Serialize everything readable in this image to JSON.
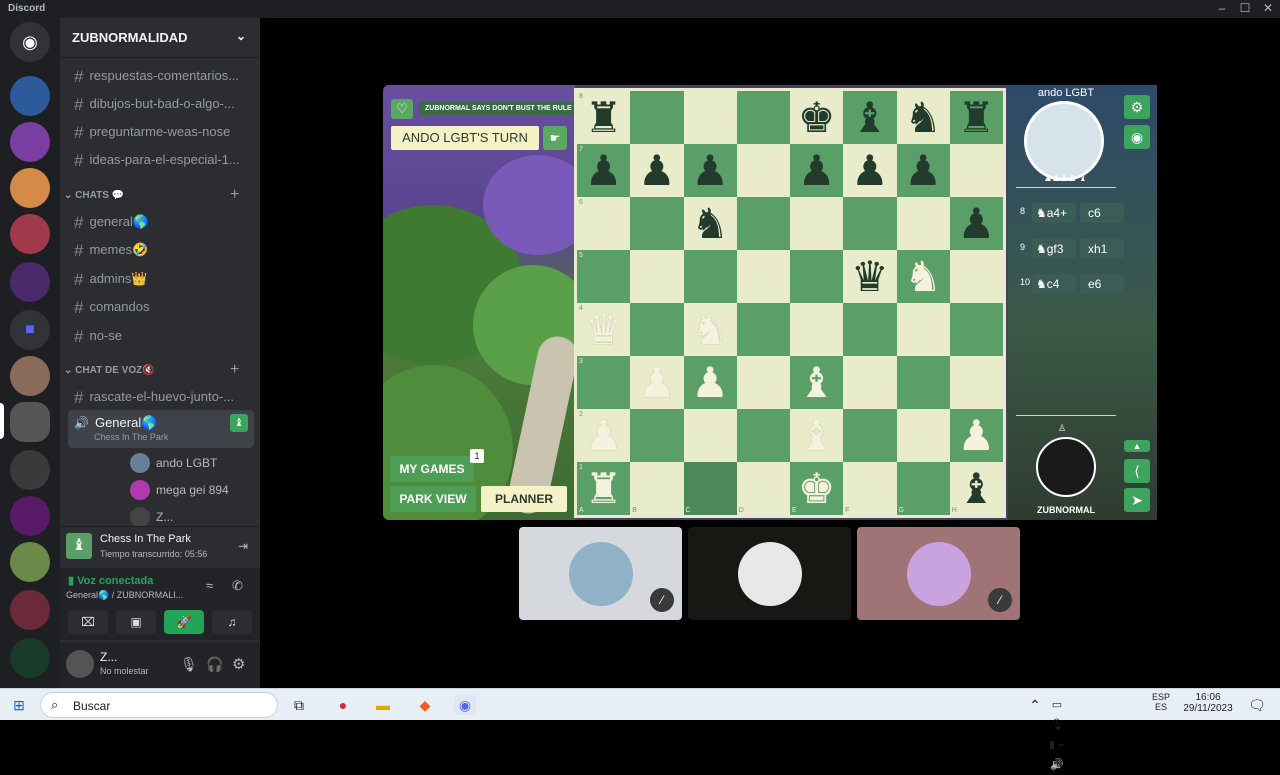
{
  "window": {
    "title": "Discord"
  },
  "server": {
    "name": "ZUBNORMALIDAD"
  },
  "channels_top": [
    {
      "name": "respuestas-comentarios..."
    },
    {
      "name": "dibujos-but-bad-o-algo-..."
    },
    {
      "name": "preguntarme-weas-nose"
    },
    {
      "name": "ideas-para-el-especial-1..."
    }
  ],
  "categories": {
    "chats": "CHATS 💬",
    "voice": "CHAT DE VOZ🔇"
  },
  "chat_channels": [
    {
      "name": "general🌎"
    },
    {
      "name": "memes🤣"
    },
    {
      "name": "admins👑"
    },
    {
      "name": "comandos"
    },
    {
      "name": "no-se"
    }
  ],
  "voice_channels": [
    {
      "name": "rascate-el-huevo-junto-..."
    },
    {
      "name": "General🌎",
      "activity": "Chess In The Park"
    }
  ],
  "voice_users": [
    {
      "name": "ando LGBT"
    },
    {
      "name": "mega gei 894"
    },
    {
      "name": "Z..."
    }
  ],
  "activity": {
    "title": "Chess In The Park",
    "elapsed": "Tiempo transcurrido: 05:56"
  },
  "voice_status": {
    "status": "Voz conectada",
    "location": "General🌎 / ZUBNORMALI..."
  },
  "user": {
    "name": "Z...",
    "status": "No molestar"
  },
  "game": {
    "rule_banner": "ZUBNORMAL SAYS DON'T BUST THE RULE",
    "turn": "ANDO LGBT'S TURN",
    "my_games": "MY GAMES",
    "my_games_badge": "1",
    "park_view": "PARK VIEW",
    "planner": "PLANNER",
    "opponent_name": "ando LGBT",
    "player_name": "ZUBNORMAL",
    "moves": [
      {
        "num": "8",
        "white": "♞a4+",
        "black": "c6"
      },
      {
        "num": "9",
        "white": "♞gf3",
        "black": "xh1"
      },
      {
        "num": "10",
        "white": "♞c4",
        "black": "e6"
      }
    ],
    "ranks": [
      "8",
      "7",
      "6",
      "5",
      "4",
      "3",
      "2",
      "1"
    ],
    "files": [
      "A",
      "B",
      "C",
      "D",
      "E",
      "F",
      "G",
      "H"
    ],
    "board": [
      [
        "br",
        "",
        "",
        "",
        "bk",
        "bb",
        "bn",
        "br"
      ],
      [
        "bp",
        "bp",
        "bp",
        "",
        "bp",
        "bp",
        "bp",
        ""
      ],
      [
        "",
        "",
        "bn",
        "",
        "",
        "",
        "",
        "bp"
      ],
      [
        "",
        "",
        "",
        "",
        "",
        "bq",
        "wn",
        ""
      ],
      [
        "wq",
        "",
        "wn",
        "",
        "",
        "",
        "",
        ""
      ],
      [
        "",
        "wp",
        "wp",
        "",
        "wb",
        "",
        "",
        ""
      ],
      [
        "wp",
        "",
        "",
        "",
        "wb",
        "",
        "",
        "wp"
      ],
      [
        "wr",
        "",
        "",
        "",
        "wk",
        "",
        "",
        "bb"
      ]
    ]
  },
  "taskbar": {
    "search": "Buscar",
    "lang1": "ESP",
    "lang2": "ES",
    "time": "16:06",
    "date": "29/11/2023"
  },
  "colors": {
    "board_light": "#e8eccb",
    "board_dark": "#5a9f68",
    "accent_green": "#23a559"
  }
}
